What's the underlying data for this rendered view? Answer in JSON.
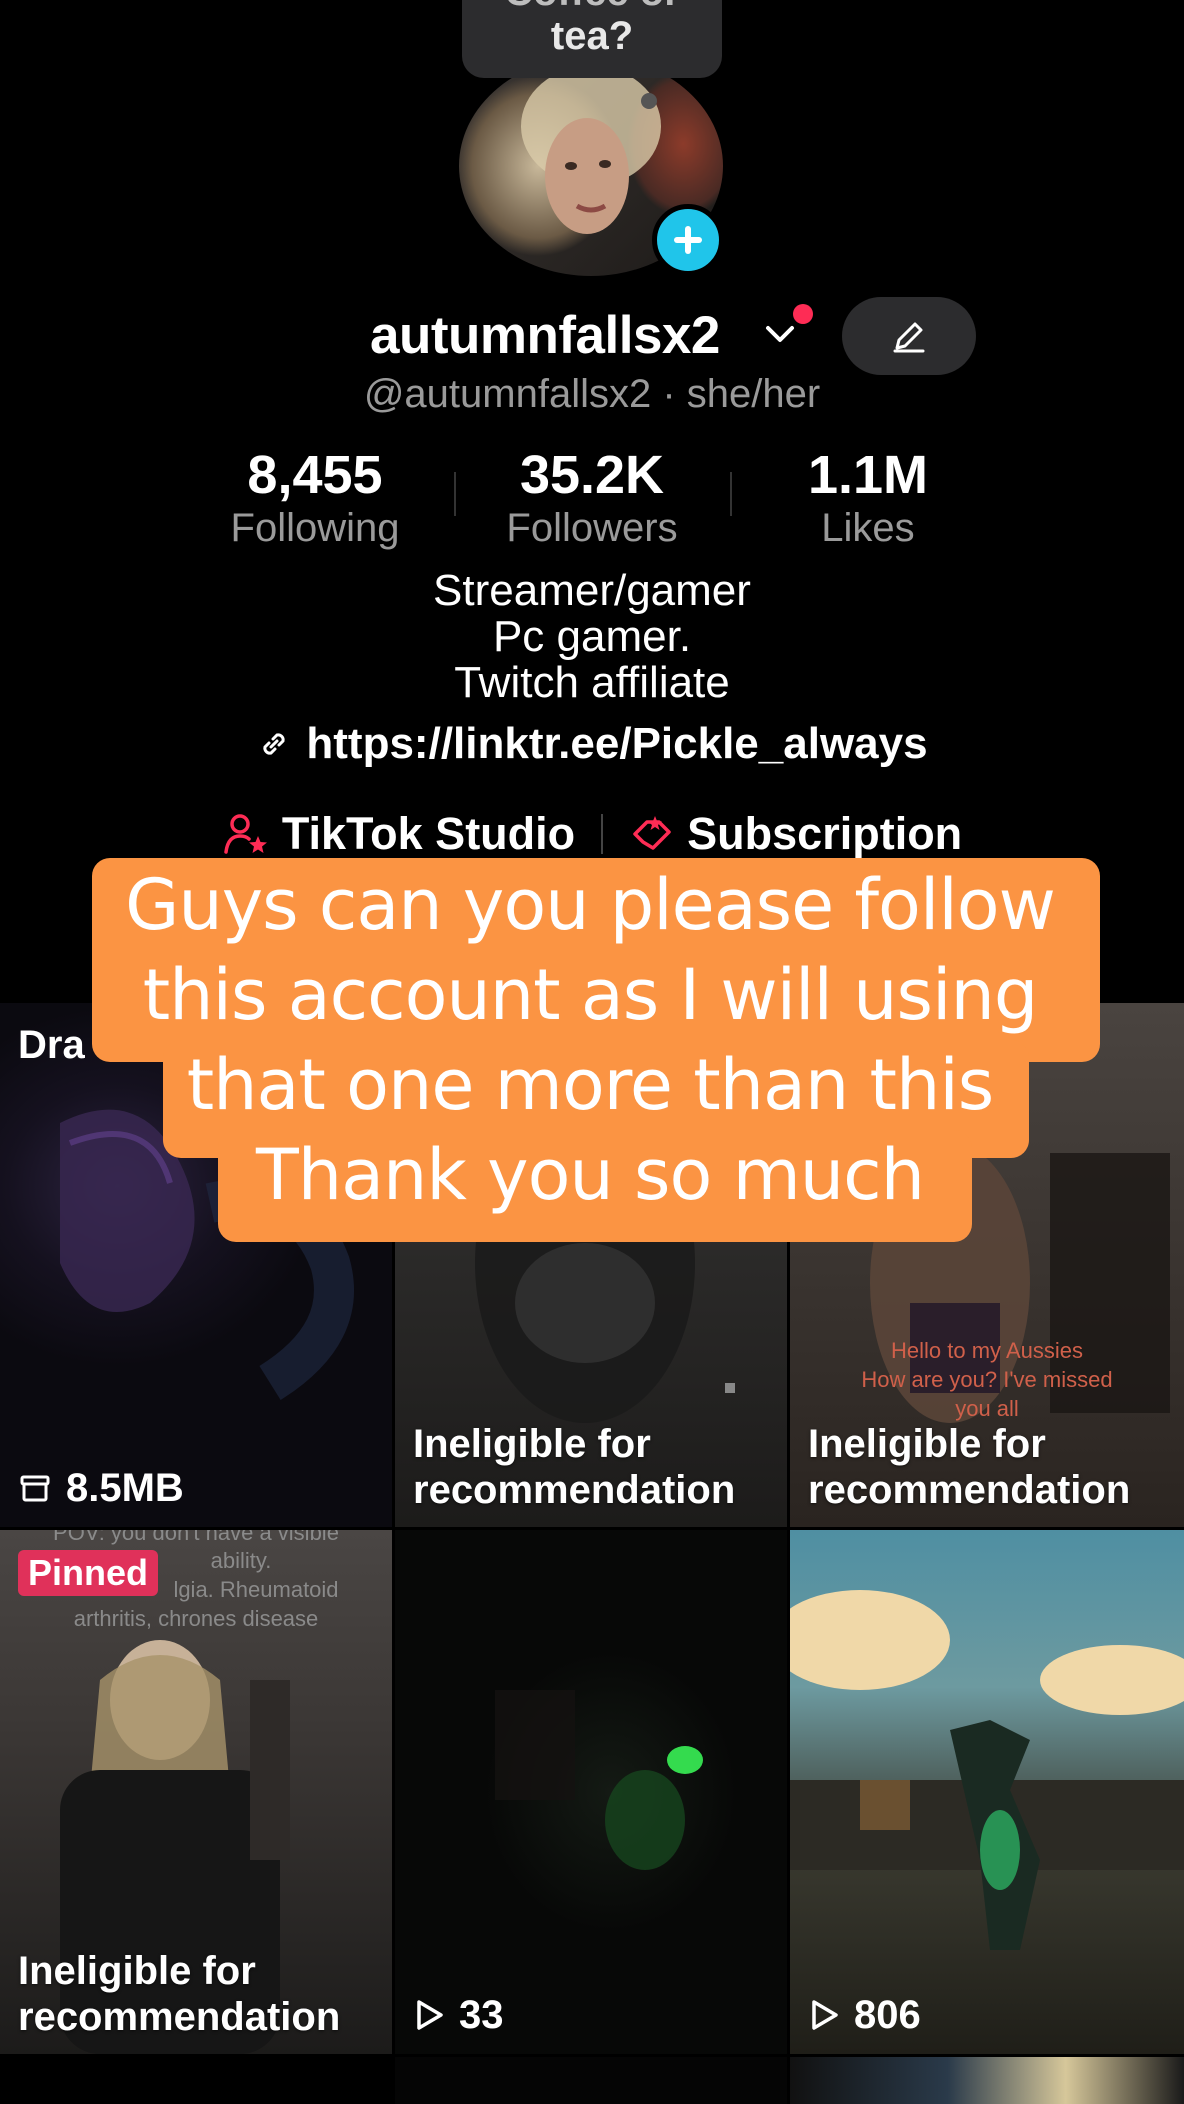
{
  "status_bubble": {
    "line1": "Coffee or",
    "line2": "tea?"
  },
  "profile": {
    "username": "autumnfallsx2",
    "handle_line": "@autumnfallsx2 · she/her",
    "stats": [
      {
        "value": "8,455",
        "label": "Following"
      },
      {
        "value": "35.2K",
        "label": "Followers"
      },
      {
        "value": "1.1M",
        "label": "Likes"
      }
    ],
    "bio": [
      "Streamer/gamer",
      "Pc gamer.",
      "Twitch affiliate"
    ],
    "link": "https://linktr.ee/Pickle_always",
    "studio_label": "TikTok Studio",
    "subscription_label": "Subscription"
  },
  "caption": {
    "lines": [
      "Guys can you please follow",
      "this account as I will using",
      "that one more than this",
      "Thank you so much"
    ]
  },
  "grid": {
    "tile1": {
      "title_fragment": "Dra",
      "size": "8.5MB"
    },
    "tile2": {
      "label_line1": "Ineligible for",
      "label_line2": "recommendation"
    },
    "tile3": {
      "label_line1": "Ineligible for",
      "label_line2": "recommendation",
      "overlay": [
        "Hello to my Aussies",
        "How are you? I've missed",
        "you all"
      ]
    },
    "tile4": {
      "pinned": "Pinned",
      "overlay": [
        "POV: you don't have a visible",
        "ability.",
        "lgia. Rheumatoid",
        "arthritis, chrones disease"
      ],
      "label_line1": "Ineligible for",
      "label_line2": "recommendation"
    },
    "tile5": {
      "views": "33"
    },
    "tile6": {
      "views": "806"
    }
  },
  "colors": {
    "accent_blue": "#20c5ea",
    "accent_red": "#fe2c55",
    "caption_bg": "#fb9443"
  }
}
